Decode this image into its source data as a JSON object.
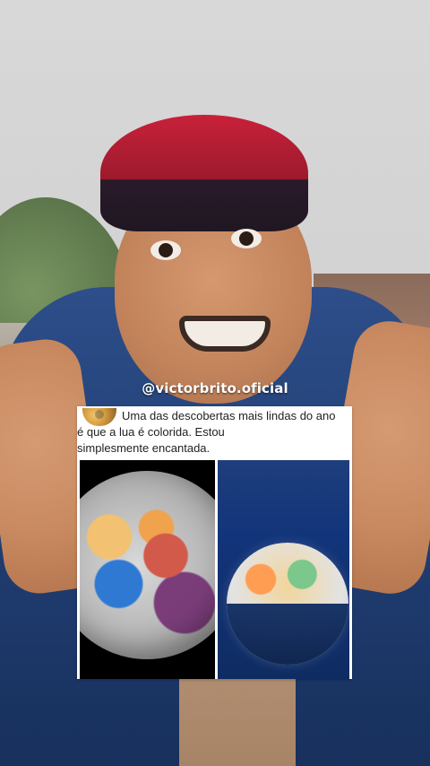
{
  "overlay": {
    "handle": "@victorbrito.oficial"
  },
  "post": {
    "caption_lines": [
      "Uma das descobertas mais lindas do ano",
      "é que a lua é colorida. Estou",
      "simplesmente encantada."
    ]
  },
  "colors": {
    "post_bg": "#ffffff",
    "caption_text": "#1f1f1f",
    "handle_text": "#ffffff"
  }
}
